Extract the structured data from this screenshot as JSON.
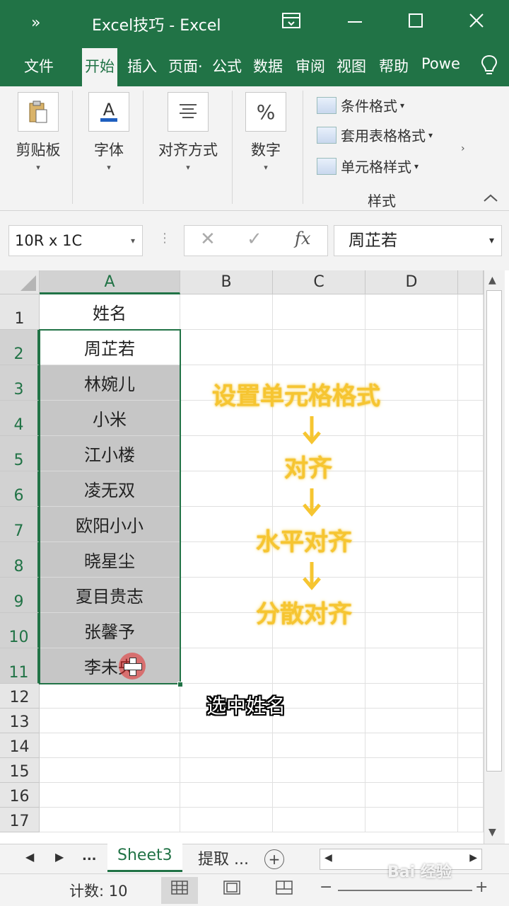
{
  "window": {
    "title": "Excel技巧  -  Excel",
    "qa_glyph": "»"
  },
  "tabs": [
    "文件",
    "开始",
    "插入",
    "页面·",
    "公式",
    "数据",
    "审阅",
    "视图",
    "帮助",
    "Powe"
  ],
  "active_tab": "开始",
  "ribbon": {
    "clipboard": "剪贴板",
    "font": "字体",
    "alignment": "对齐方式",
    "number": "数字",
    "number_icon": "%",
    "conditional": "条件格式",
    "table_format": "套用表格格式",
    "cell_style": "单元格样式",
    "styles_group": "样式",
    "dropdown": "▾"
  },
  "formula_bar": {
    "name_box": "10R x 1C",
    "fx": "fx",
    "cancel": "✕",
    "enter": "✓",
    "value": "周芷若"
  },
  "columns": [
    "A",
    "B",
    "C",
    "D"
  ],
  "rows": [
    "1",
    "2",
    "3",
    "4",
    "5",
    "6",
    "7",
    "8",
    "9",
    "10",
    "11",
    "12",
    "13",
    "14",
    "15",
    "16",
    "17"
  ],
  "column_a_values": [
    "姓名",
    "周芷若",
    "林婉儿",
    "小米",
    "江小楼",
    "凌无双",
    "欧阳小小",
    "晓星尘",
    "夏目贵志",
    "张馨予",
    "李未央"
  ],
  "overlay": {
    "step1": "设置单元格格式",
    "step2": "对齐",
    "step3": "水平对齐",
    "step4": "分散对齐",
    "caption": "选中姓名"
  },
  "sheets": {
    "ellipsis": "...",
    "active": "Sheet3",
    "other": "提取 ...",
    "add": "+"
  },
  "status": {
    "count": "计数: 10",
    "zoom_minus": "−",
    "zoom_plus": "+",
    "watermark": "Bai 经验"
  },
  "colors": {
    "excel_green": "#217346",
    "selection_fill": "#c6c6c6",
    "overlay_text": "#f6c531"
  }
}
